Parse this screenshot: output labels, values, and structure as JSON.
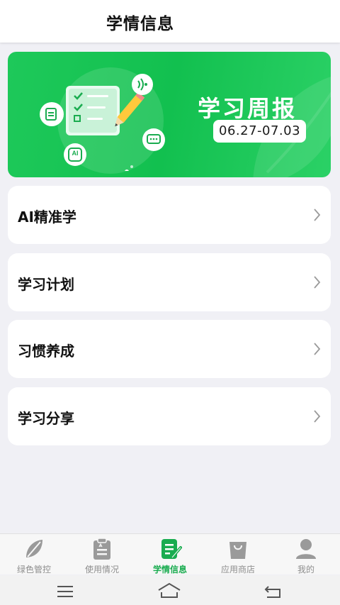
{
  "header": {
    "title": "学情信息"
  },
  "banner": {
    "headline": "学习周报",
    "date_range": "06.27-07.03",
    "illustration_badge": "AI"
  },
  "menu": [
    {
      "label": "AI精准学"
    },
    {
      "label": "学习计划"
    },
    {
      "label": "习惯养成"
    },
    {
      "label": "学习分享"
    }
  ],
  "tabbar": {
    "tabs": [
      {
        "label": "绿色管控",
        "icon": "leaf-icon"
      },
      {
        "label": "使用情况",
        "icon": "clipboard-icon"
      },
      {
        "label": "学情信息",
        "icon": "notes-icon"
      },
      {
        "label": "应用商店",
        "icon": "shopping-bag-icon"
      },
      {
        "label": "我的",
        "icon": "person-icon"
      }
    ],
    "active_label": "学情信息"
  },
  "colors": {
    "accent": "#1aac50",
    "banner": "#12c04f"
  }
}
